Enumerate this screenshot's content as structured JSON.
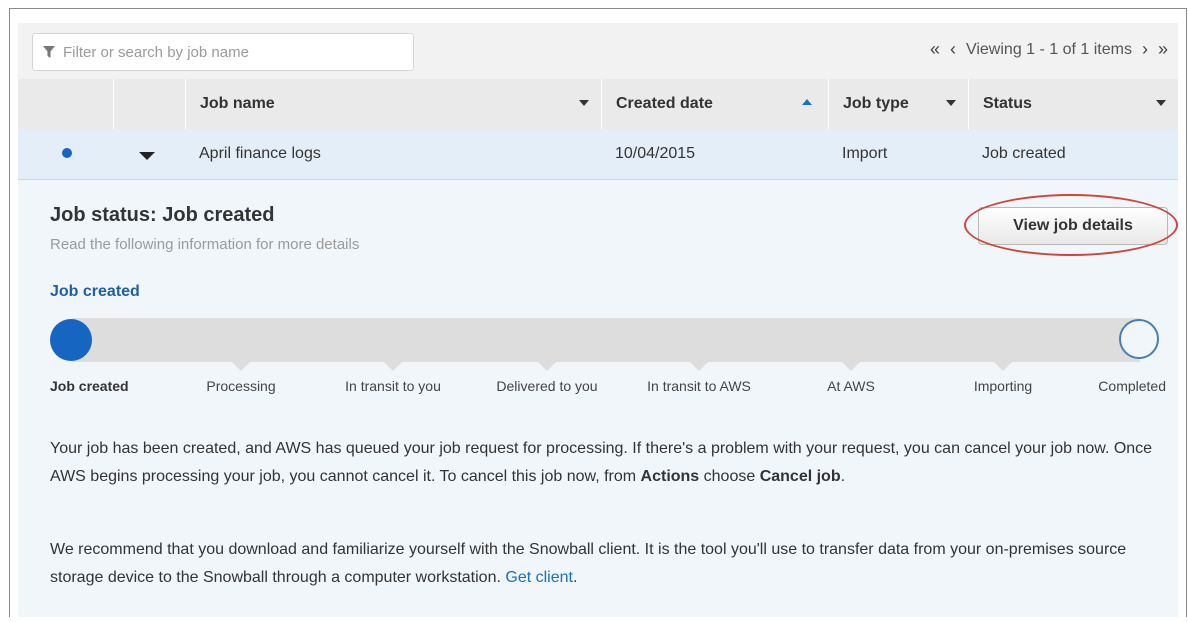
{
  "toolbar": {
    "search_placeholder": "Filter or search by job name",
    "pager_text": "Viewing 1 - 1 of 1 items",
    "first_glyph": "«",
    "prev_glyph": "‹",
    "next_glyph": "›",
    "last_glyph": "»"
  },
  "table": {
    "columns": [
      "Job name",
      "Created date",
      "Job type",
      "Status"
    ],
    "rows": [
      {
        "job_name": "April finance logs",
        "created_date": "10/04/2015",
        "job_type": "Import",
        "status": "Job created"
      }
    ]
  },
  "detail": {
    "title": "Job status: Job created",
    "subtitle": "Read the following information for more details",
    "view_button": "View job details",
    "current_stage": "Job created",
    "stages": [
      "Job created",
      "Processing",
      "In transit to you",
      "Delivered to you",
      "In transit to AWS",
      "At AWS",
      "Importing",
      "Completed"
    ],
    "para1_a": "Your job has been created, and AWS has queued your job request for processing. If there's a problem with your request, you can cancel your job now. Once AWS begins processing your job, you cannot cancel it. To cancel this job now, from ",
    "para1_b": "Actions",
    "para1_c": " choose ",
    "para1_d": "Cancel job",
    "para1_e": ".",
    "para2_a": "We recommend that you download and familiarize yourself with the Snowball client. It is the tool you'll use to transfer data from your on-premises source storage device to the Snowball through a computer workstation. ",
    "para2_link": "Get client",
    "para2_end": "."
  },
  "colors": {
    "accent": "#1665c1",
    "row_selected": "#e4eef9",
    "panel": "#f1f6fb",
    "highlight_oval": "#d2433e"
  },
  "icons": [
    "filter-icon",
    "first-page-icon",
    "prev-page-icon",
    "next-page-icon",
    "last-page-icon",
    "sort-caret-icon",
    "sort-ascending-icon",
    "expand-caret-icon"
  ]
}
